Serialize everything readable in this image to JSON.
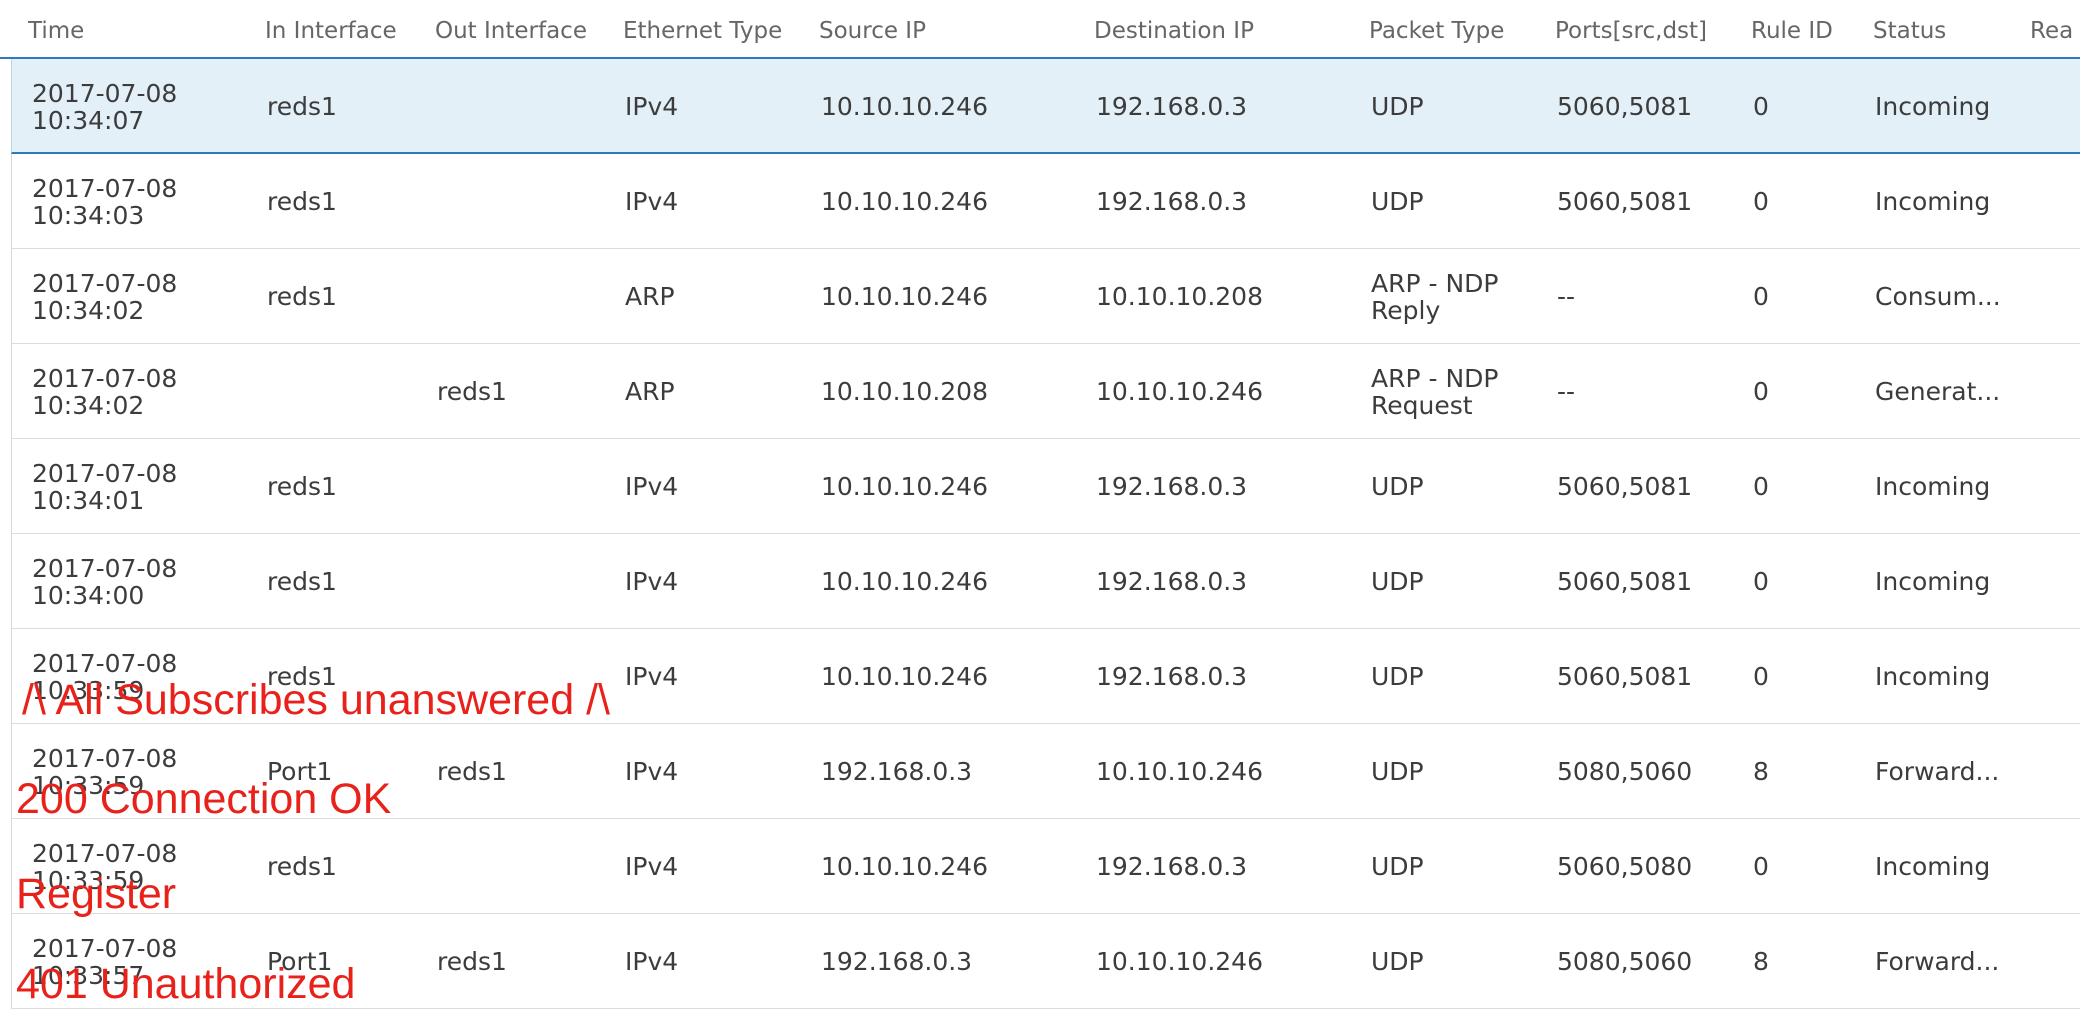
{
  "columns": [
    "Time",
    "In Interface",
    "Out Interface",
    "Ethernet Type",
    "Source IP",
    "Destination IP",
    "Packet Type",
    "Ports[src,dst]",
    "Rule ID",
    "Status",
    "Rea"
  ],
  "rows": [
    {
      "date": "2017-07-08",
      "time": "10:34:07",
      "in_if": "reds1",
      "out_if": "",
      "eth": "IPv4",
      "src": "10.10.10.246",
      "dst": "192.168.0.3",
      "pkt1": "UDP",
      "pkt2": "",
      "ports": "5060,5081",
      "rule": "0",
      "status": "Incoming"
    },
    {
      "date": "2017-07-08",
      "time": "10:34:03",
      "in_if": "reds1",
      "out_if": "",
      "eth": "IPv4",
      "src": "10.10.10.246",
      "dst": "192.168.0.3",
      "pkt1": "UDP",
      "pkt2": "",
      "ports": "5060,5081",
      "rule": "0",
      "status": "Incoming"
    },
    {
      "date": "2017-07-08",
      "time": "10:34:02",
      "in_if": "reds1",
      "out_if": "",
      "eth": "ARP",
      "src": "10.10.10.246",
      "dst": "10.10.10.208",
      "pkt1": "ARP - NDP",
      "pkt2": "Reply",
      "ports": "--",
      "rule": "0",
      "status": "Consum..."
    },
    {
      "date": "2017-07-08",
      "time": "10:34:02",
      "in_if": "",
      "out_if": "reds1",
      "eth": "ARP",
      "src": "10.10.10.208",
      "dst": "10.10.10.246",
      "pkt1": "ARP - NDP",
      "pkt2": "Request",
      "ports": "--",
      "rule": "0",
      "status": "Generat..."
    },
    {
      "date": "2017-07-08",
      "time": "10:34:01",
      "in_if": "reds1",
      "out_if": "",
      "eth": "IPv4",
      "src": "10.10.10.246",
      "dst": "192.168.0.3",
      "pkt1": "UDP",
      "pkt2": "",
      "ports": "5060,5081",
      "rule": "0",
      "status": "Incoming"
    },
    {
      "date": "2017-07-08",
      "time": "10:34:00",
      "in_if": "reds1",
      "out_if": "",
      "eth": "IPv4",
      "src": "10.10.10.246",
      "dst": "192.168.0.3",
      "pkt1": "UDP",
      "pkt2": "",
      "ports": "5060,5081",
      "rule": "0",
      "status": "Incoming"
    },
    {
      "date": "2017-07-08",
      "time": "10:33:59",
      "in_if": "reds1",
      "out_if": "",
      "eth": "IPv4",
      "src": "10.10.10.246",
      "dst": "192.168.0.3",
      "pkt1": "UDP",
      "pkt2": "",
      "ports": "5060,5081",
      "rule": "0",
      "status": "Incoming"
    },
    {
      "date": "2017-07-08",
      "time": "10:33:59",
      "in_if": "Port1",
      "out_if": "reds1",
      "eth": "IPv4",
      "src": "192.168.0.3",
      "dst": "10.10.10.246",
      "pkt1": "UDP",
      "pkt2": "",
      "ports": "5080,5060",
      "rule": "8",
      "status": "Forward..."
    },
    {
      "date": "2017-07-08",
      "time": "10:33:59",
      "in_if": "reds1",
      "out_if": "",
      "eth": "IPv4",
      "src": "10.10.10.246",
      "dst": "192.168.0.3",
      "pkt1": "UDP",
      "pkt2": "",
      "ports": "5060,5080",
      "rule": "0",
      "status": "Incoming"
    },
    {
      "date": "2017-07-08",
      "time": "10:33:57",
      "in_if": "Port1",
      "out_if": "reds1",
      "eth": "IPv4",
      "src": "192.168.0.3",
      "dst": "10.10.10.246",
      "pkt1": "UDP",
      "pkt2": "",
      "ports": "5080,5060",
      "rule": "8",
      "status": "Forward..."
    }
  ],
  "annotations": [
    "/\\ All Subscribes unanswered /\\",
    "200 Connection OK",
    "Register",
    "401 Unauthorized"
  ]
}
